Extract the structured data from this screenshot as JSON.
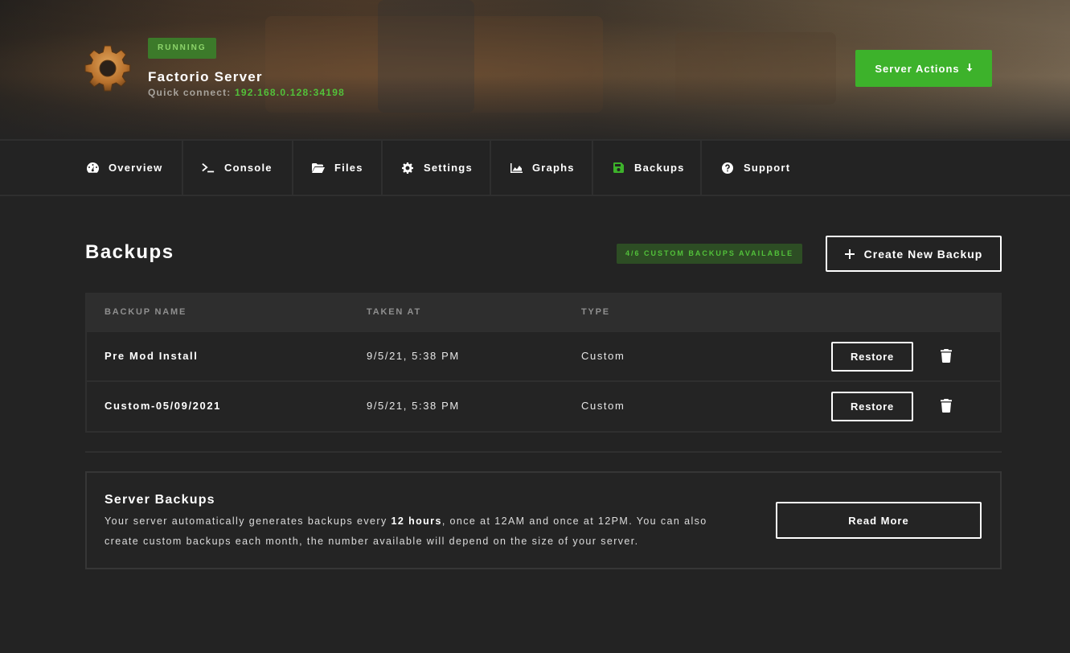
{
  "header": {
    "status": "RUNNING",
    "server_name": "Factorio Server",
    "quick_connect_label": "Quick connect:",
    "quick_connect_address": "192.168.0.128:34198",
    "actions_label": "Server Actions",
    "actions_icon": "arrow-down-icon"
  },
  "nav": {
    "items": [
      {
        "label": "Overview",
        "icon": "dashboard-icon"
      },
      {
        "label": "Console",
        "icon": "terminal-icon"
      },
      {
        "label": "Files",
        "icon": "folder-icon"
      },
      {
        "label": "Settings",
        "icon": "gear-icon"
      },
      {
        "label": "Graphs",
        "icon": "chart-icon"
      },
      {
        "label": "Backups",
        "icon": "save-icon",
        "active": true
      },
      {
        "label": "Support",
        "icon": "question-icon"
      }
    ]
  },
  "backups": {
    "title": "Backups",
    "available_badge": "4/6 CUSTOM BACKUPS AVAILABLE",
    "create_label": "Create New Backup",
    "columns": [
      "BACKUP NAME",
      "TAKEN AT",
      "TYPE"
    ],
    "rows": [
      {
        "name": "Pre Mod Install",
        "taken_at": "9/5/21, 5:38 PM",
        "type": "Custom",
        "restore_label": "Restore"
      },
      {
        "name": "Custom-05/09/2021",
        "taken_at": "9/5/21, 5:38 PM",
        "type": "Custom",
        "restore_label": "Restore"
      }
    ]
  },
  "info": {
    "title": "Server Backups",
    "text_before": "Your server automatically generates backups every ",
    "text_bold": "12 hours",
    "text_after": ", once at 12AM and once at 12PM. You can also create custom backups each month, the number available will depend on the size of your server.",
    "read_more_label": "Read More"
  },
  "colors": {
    "accent": "#3db22b",
    "background": "#232323",
    "status_badge_bg": "#3c7a2a"
  }
}
